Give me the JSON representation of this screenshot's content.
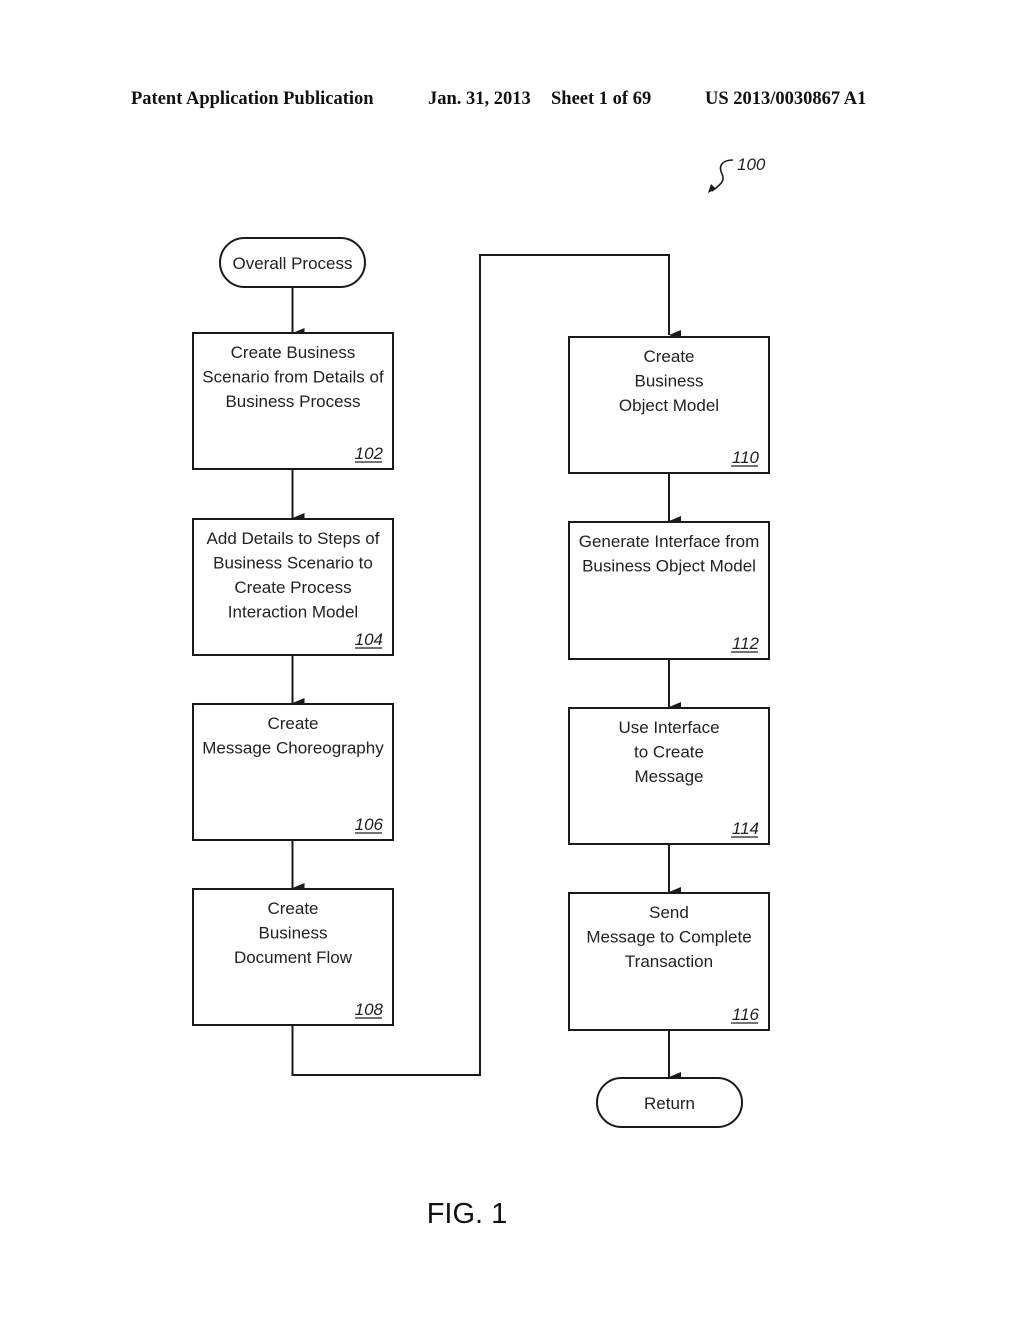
{
  "header": {
    "publication": "Patent Application Publication",
    "date": "Jan. 31, 2013",
    "sheet": "Sheet 1 of 69",
    "patent_number": "US 2013/0030867 A1"
  },
  "figure_ref": "100",
  "figure_label": "FIG. 1",
  "terminals": {
    "start": "Overall Process",
    "end": "Return"
  },
  "steps": [
    {
      "ref": "102",
      "lines": [
        "Create Business",
        "Scenario from Details of",
        "Business Process"
      ]
    },
    {
      "ref": "104",
      "lines": [
        "Add Details to Steps of",
        "Business Scenario to",
        "Create Process",
        "Interaction Model"
      ]
    },
    {
      "ref": "106",
      "lines": [
        "Create",
        "Message Choreography"
      ]
    },
    {
      "ref": "108",
      "lines": [
        "Create",
        "Business",
        "Document Flow"
      ]
    },
    {
      "ref": "110",
      "lines": [
        "Create",
        "Business",
        "Object Model"
      ]
    },
    {
      "ref": "112",
      "lines": [
        "Generate Interface from",
        "Business Object Model"
      ]
    },
    {
      "ref": "114",
      "lines": [
        "Use Interface",
        "to Create",
        "Message"
      ]
    },
    {
      "ref": "116",
      "lines": [
        "Send",
        "Message to Complete",
        "Transaction"
      ]
    }
  ],
  "colors": {
    "line": "#1a1a1a",
    "text": "#222222",
    "background": "#ffffff"
  }
}
